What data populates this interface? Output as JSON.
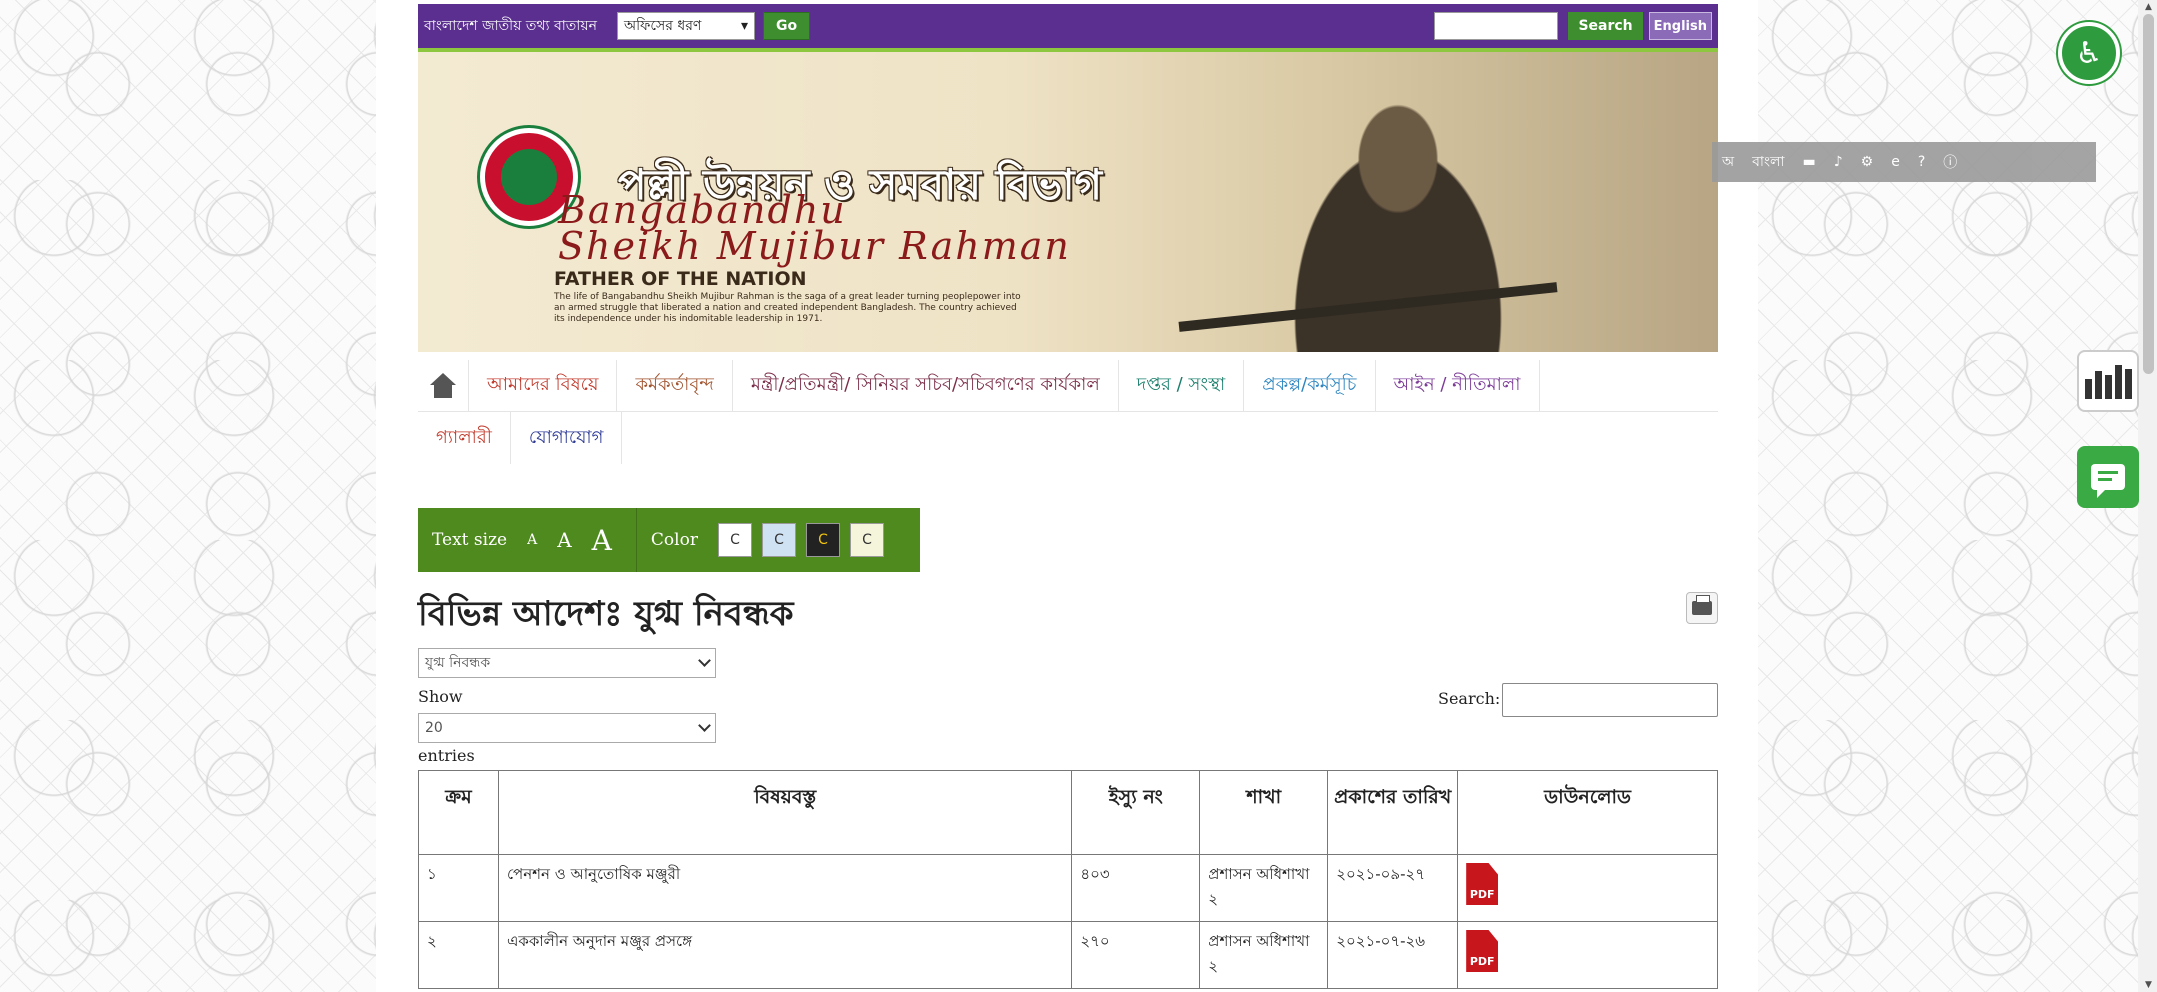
{
  "topbar": {
    "portal_label": "বাংলাদেশ জাতীয় তথ্য বাতায়ন",
    "office_select": "অফিসের ধরণ",
    "go_label": "Go",
    "search_label": "Search",
    "english_label": "English"
  },
  "banner": {
    "dept_title": "পল্লী উন্নয়ন ও সমবায় বিভাগ",
    "line1": "Bangabandhu",
    "line2": "Sheikh Mujibur Rahman",
    "father": "FATHER OF THE NATION",
    "blurb": "The life of Bangabandhu Sheikh Mujibur Rahman is the saga of a great leader turning peoplepower into an armed struggle that liberated a nation and created independent Bangladesh. The country achieved its independence under his indomitable leadership in 1971."
  },
  "nav": {
    "row1": [
      {
        "label": "আমাদের বিষয়ে",
        "color": "#c0392b"
      },
      {
        "label": "কর্মকর্তাবৃন্দ",
        "color": "#a0522d"
      },
      {
        "label": "মন্ত্রী/প্রতিমন্ত্রী/ সিনিয়র সচিব/সচিবগণের কার্যকাল",
        "color": "#7b2d4a"
      },
      {
        "label": "দপ্তর / সংস্থা",
        "color": "#1a7f6b"
      },
      {
        "label": "প্রকল্প/কর্মসূচি",
        "color": "#2e86c1"
      },
      {
        "label": "আইন / নীতিমালা",
        "color": "#7d3c98"
      }
    ],
    "row2": [
      {
        "label": "গ্যালারী",
        "color": "#c0392b"
      },
      {
        "label": "যোগাযোগ",
        "color": "#283593"
      }
    ]
  },
  "acc_tool": {
    "text_size_label": "Text size",
    "sizes": [
      "A",
      "A",
      "A"
    ],
    "color_label": "Color",
    "color_boxes": [
      "C",
      "C",
      "C",
      "C"
    ]
  },
  "page": {
    "heading": "বিভিন্ন আদেশঃ যুগ্ম নিবন্ধক",
    "filter_value": "যুগ্ম নিবন্ধক",
    "show_label": "Show",
    "show_value": "20",
    "entries_label": "entries",
    "search_label": "Search:"
  },
  "table": {
    "headers": [
      "ক্রম",
      "বিষয়বস্তু",
      "ইস্যু নং",
      "শাখা",
      "প্রকাশের তারিখ",
      "ডাউনলোড"
    ],
    "rows": [
      {
        "serial": "১",
        "subject": "পেনশন ও আনুতোষিক মঞ্জুরী",
        "issue": "৪০৩",
        "branch": "প্রশাসন অধিশাখা ২",
        "date": "২০২১-০৯-২৭",
        "download": "PDF"
      },
      {
        "serial": "২",
        "subject": "এককালীন অনুদান মঞ্জুর প্রসঙ্গে",
        "issue": "২৭০",
        "branch": "প্রশাসন অধিশাখা ২",
        "date": "২০২১-০৭-২৬",
        "download": "PDF"
      }
    ]
  },
  "access_bar": {
    "items": [
      "অ",
      "বাংলা"
    ]
  },
  "colors": {
    "topbar": "#5b2f8f",
    "green": "#4f8a1f",
    "accent_green": "#3e8e2f"
  }
}
